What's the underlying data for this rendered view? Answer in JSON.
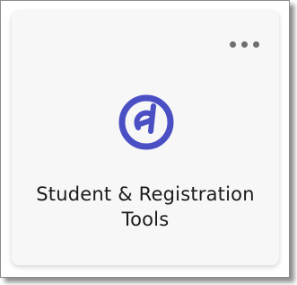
{
  "tile": {
    "title": "Student & Registration Tools",
    "menu_icon": "more-horizontal-icon",
    "app_icon": "student-registration-logo-icon",
    "accent_color": "#4a4fc4",
    "menu_color": "#6e6e6e",
    "background": "#f7f7f7"
  }
}
